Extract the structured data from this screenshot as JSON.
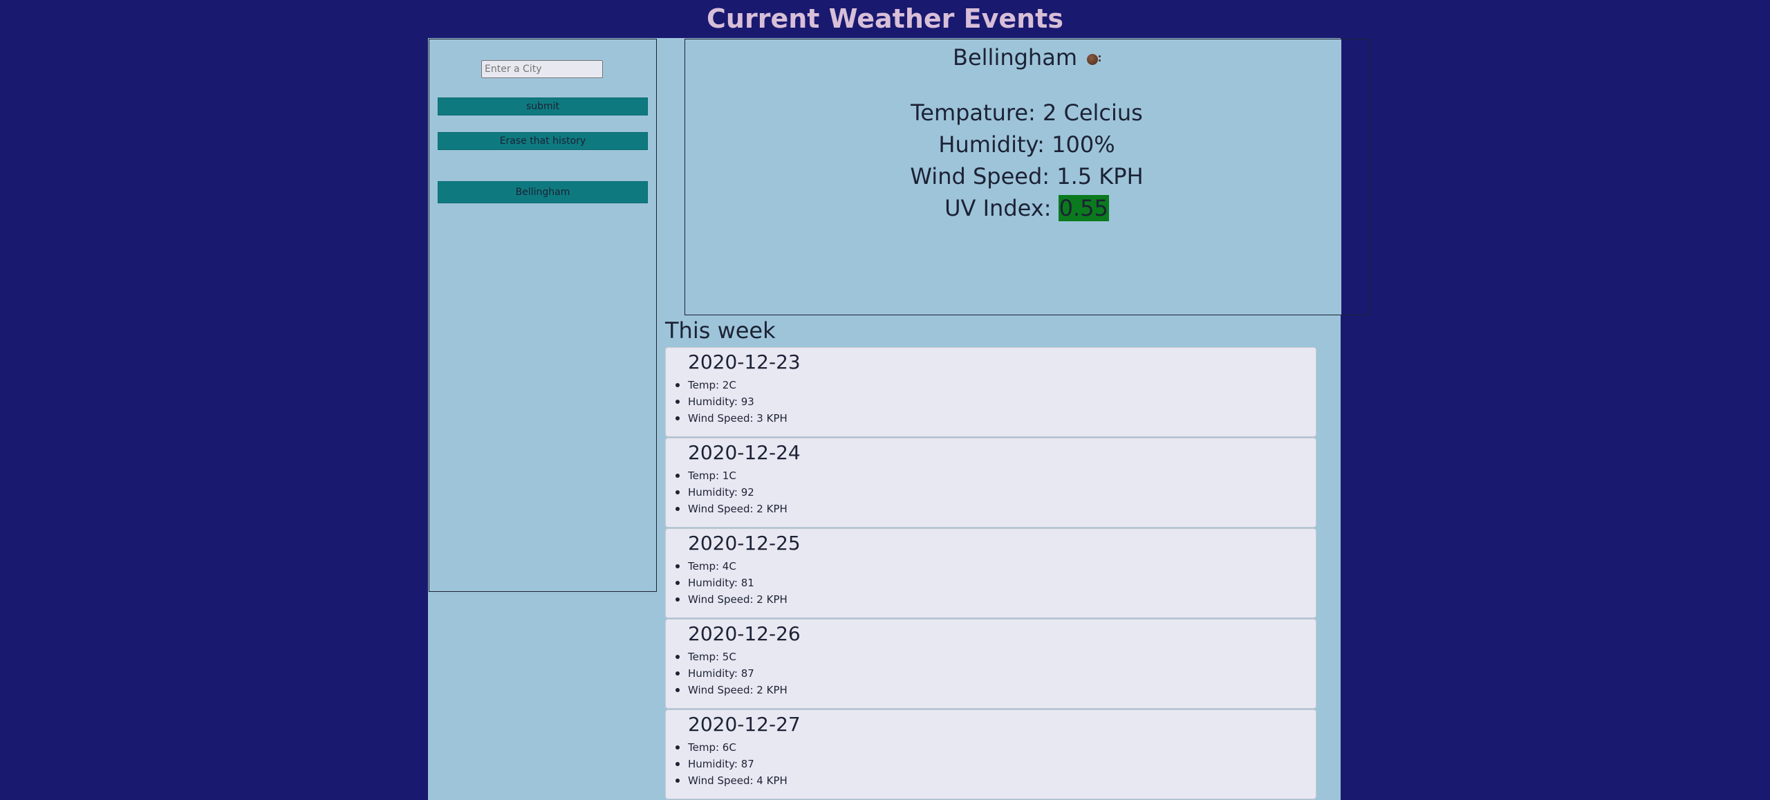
{
  "header": {
    "title": "Current Weather Events"
  },
  "sidebar": {
    "search_placeholder": "Enter a City",
    "search_value": "",
    "submit_label": "submit",
    "erase_label": "Erase that history",
    "history": [
      "Bellingham"
    ]
  },
  "current": {
    "city": "Bellingham",
    "icon": "weather-icon",
    "temperature_text": "Tempature: 2 Celcius",
    "humidity_text": "Humidity: 100%",
    "wind_text": "Wind Speed: 1.5 KPH",
    "uv_label": "UV Index: ",
    "uv_value": "0.55",
    "uv_color": "#0b7a1e"
  },
  "week": {
    "title": "This week",
    "days": [
      {
        "date": "2020-12-23",
        "temp": "Temp: 2C",
        "humidity": "Humidity: 93",
        "wind": "Wind Speed: 3 KPH"
      },
      {
        "date": "2020-12-24",
        "temp": "Temp: 1C",
        "humidity": "Humidity: 92",
        "wind": "Wind Speed: 2 KPH"
      },
      {
        "date": "2020-12-25",
        "temp": "Temp: 4C",
        "humidity": "Humidity: 81",
        "wind": "Wind Speed: 2 KPH"
      },
      {
        "date": "2020-12-26",
        "temp": "Temp: 5C",
        "humidity": "Humidity: 87",
        "wind": "Wind Speed: 2 KPH"
      },
      {
        "date": "2020-12-27",
        "temp": "Temp: 6C",
        "humidity": "Humidity: 87",
        "wind": "Wind Speed: 4 KPH"
      }
    ]
  },
  "colors": {
    "background": "#191970",
    "title": "#d8bfd8",
    "panel": "#9ec4d9",
    "button": "#0e7a80",
    "card": "#e8e8f2"
  }
}
